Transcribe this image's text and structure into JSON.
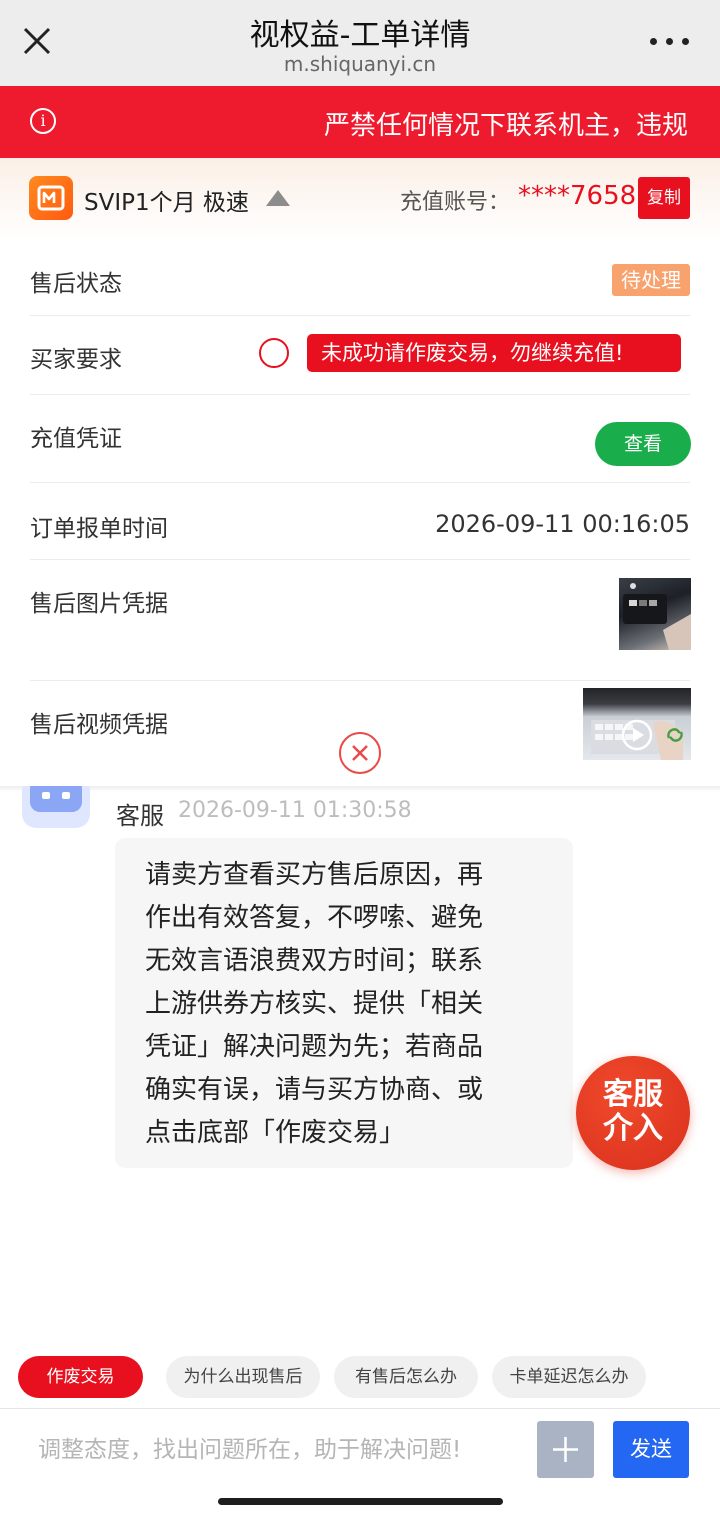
{
  "header": {
    "title": "视权益-工单详情",
    "domain": "m.shiquanyi.cn"
  },
  "banner": {
    "text": "严禁任何情况下联系机主，违规"
  },
  "product": {
    "name": "SVIP1个月 极速",
    "account_label": "充值账号：",
    "account_value": "****7658",
    "copy_label": "复制"
  },
  "details": {
    "status_label": "售后状态",
    "status_value": "待处理",
    "buyer_req_label": "买家要求",
    "buyer_req_value": "未成功请作废交易，勿继续充值!",
    "voucher_label": "充值凭证",
    "view_label": "查看",
    "order_time_label": "订单报单时间",
    "order_time_value": "2026-09-11 00:16:05",
    "image_proof_label": "售后图片凭据",
    "video_proof_label": "售后视频凭据"
  },
  "chat": {
    "sender": "客服",
    "time": "2026-09-11 01:30:58",
    "lines": [
      "请卖方查看买方售后原因，再",
      "作出有效答复，不啰嗦、避免",
      "无效言语浪费双方时间；联系",
      "上游供券方核实、提供「相关",
      "凭证」解决问题为先；若商品",
      "确实有误，请与买方协商、或",
      "点击底部「作废交易」"
    ]
  },
  "fab": {
    "line1": "客服",
    "line2": "介入"
  },
  "quick_actions": [
    "作废交易",
    "为什么出现售后",
    "有售后怎么办",
    "卡单延迟怎么办"
  ],
  "input": {
    "placeholder": "调整态度，找出问题所在，助于解决问题!",
    "send_label": "发送"
  },
  "colors": {
    "primary_red": "#e8101f",
    "send_blue": "#2467f2",
    "green": "#1aad4b",
    "pending_orange": "#f8a26e"
  }
}
